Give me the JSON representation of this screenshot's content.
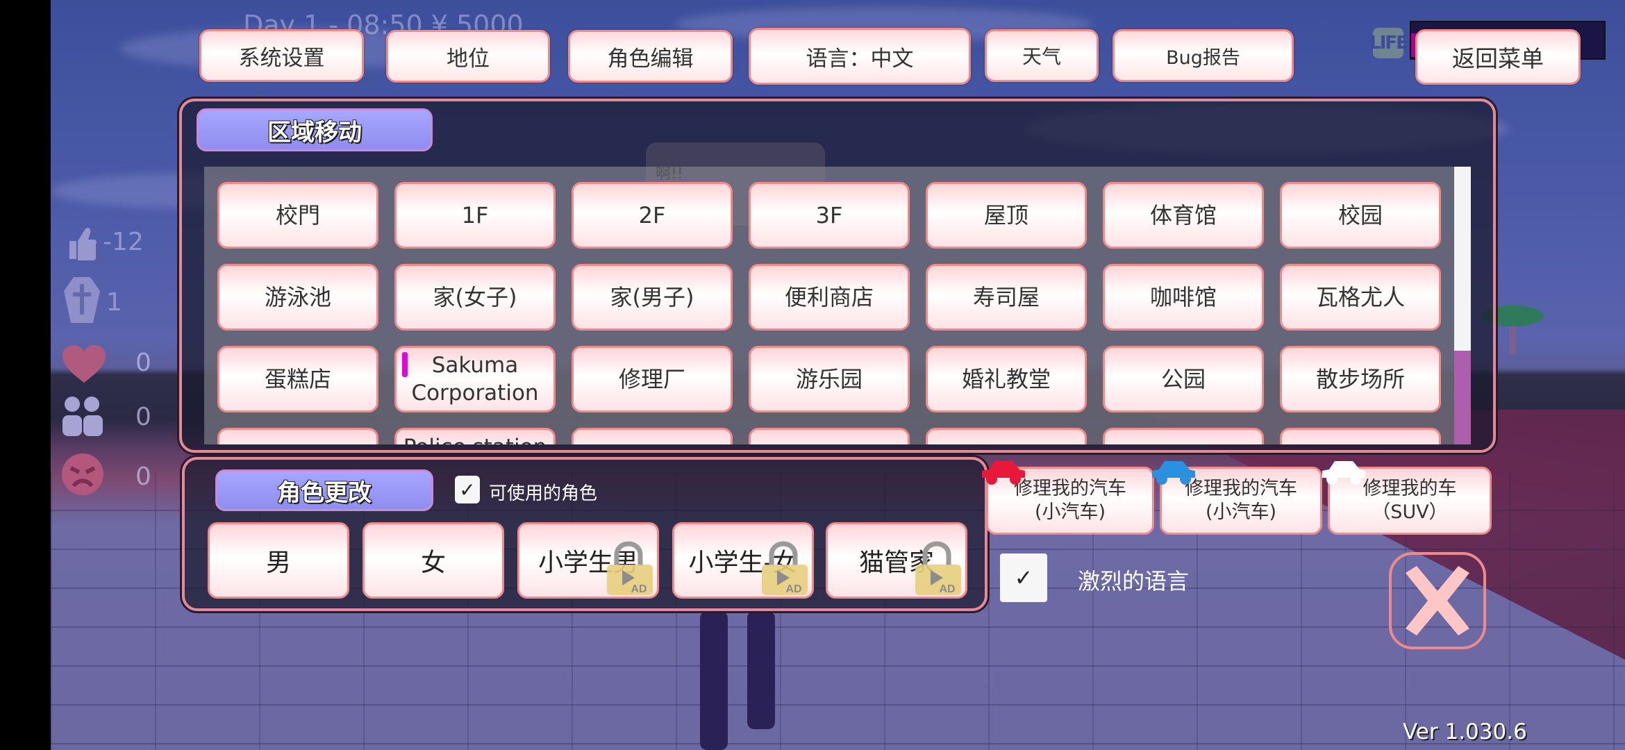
{
  "hud": {
    "status_line": "Day 1 - 08:50  ¥ 5000",
    "life_label": "LIFE",
    "life_fraction": 0.05,
    "stats": [
      {
        "icon": "thumbs-up-icon",
        "value": "-12"
      },
      {
        "icon": "coffin-icon",
        "value": "1"
      },
      {
        "icon": "heart-icon",
        "value": "0"
      },
      {
        "icon": "friends-icon",
        "value": "0"
      },
      {
        "icon": "angry-face-icon",
        "value": "0"
      }
    ],
    "speech_bubble": "啊!!",
    "version": "Ver 1.030.6"
  },
  "toolbar": {
    "system_settings": "系统设置",
    "status": "地位",
    "character_edit": "角色编辑",
    "language": "语言：中文",
    "weather": "天气",
    "bug_report": "Bug报告",
    "return_menu": "返回菜单"
  },
  "area_move": {
    "title": "区域移动",
    "rows": [
      [
        "校門",
        "1F",
        "2F",
        "3F",
        "屋顶",
        "体育馆",
        "校园"
      ],
      [
        "游泳池",
        "家(女子)",
        "家(男子)",
        "便利商店",
        "寿司屋",
        "咖啡馆",
        "瓦格尤人"
      ],
      [
        "蛋糕店",
        "Sakuma\nCorporation",
        "修理厂",
        "游乐园",
        "婚礼教堂",
        "公园",
        "散步场所"
      ],
      [
        "",
        "Police station",
        "",
        "",
        "",
        "",
        ""
      ]
    ],
    "scroll_position": 0.0
  },
  "character_change": {
    "title": "角色更改",
    "available_checkbox_label": "可使用的角色",
    "available_checked": true,
    "buttons": [
      {
        "label": "男",
        "locked": false
      },
      {
        "label": "女",
        "locked": false
      },
      {
        "label": "小学生男",
        "locked": true
      },
      {
        "label": "小学生-女",
        "locked": true
      },
      {
        "label": "猫管家",
        "locked": true
      }
    ],
    "lock_badge": "AD"
  },
  "car_repair": [
    {
      "label": "修理我的汽车\n(小汽车)",
      "car_color": "#e8183a"
    },
    {
      "label": "修理我的汽车\n(小汽车)",
      "car_color": "#2a90e0"
    },
    {
      "label": "修理我的车（SUV）",
      "car_color": "#ffffff"
    }
  ],
  "strong_language": {
    "label": "激烈的语言",
    "checked": true
  },
  "colors": {
    "button_border": "#f28a8a",
    "tag_fill": "#9c9cf8",
    "life_fill": "#b0008f",
    "close_x": "#ffc6c6"
  }
}
